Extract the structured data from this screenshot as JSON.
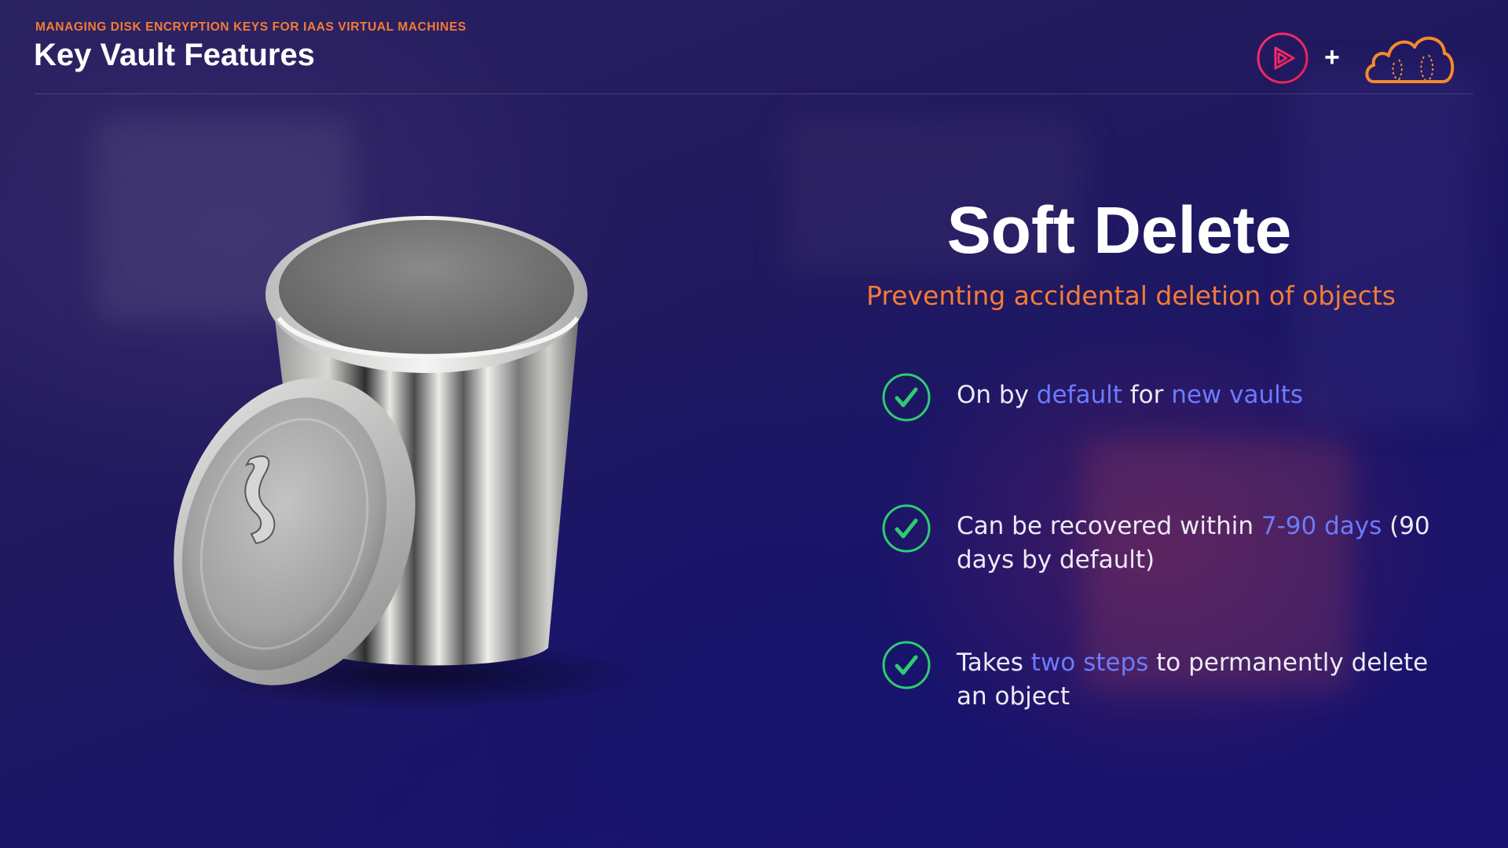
{
  "header": {
    "kicker": "MANAGING DISK ENCRYPTION KEYS FOR IAAS VIRTUAL MACHINES",
    "title": "Key Vault Features",
    "plus": "+"
  },
  "slide": {
    "title": "Soft Delete",
    "subtitle": "Preventing accidental deletion of objects",
    "features": [
      {
        "icon": "checkmark-circle-icon",
        "parts": [
          "On by ",
          "default",
          " for ",
          "new vaults"
        ]
      },
      {
        "icon": "checkmark-circle-icon",
        "parts": [
          "Can be recovered within ",
          "7-90 days",
          " (90 days by default)"
        ]
      },
      {
        "icon": "checkmark-circle-icon",
        "parts": [
          "Takes ",
          "two steps",
          " to permanently delete an object"
        ]
      }
    ]
  },
  "colors": {
    "accent_orange": "#f47b36",
    "highlight_blue": "#6b7cff",
    "check_green": "#2ecc71",
    "logo_pink": "#e8204f"
  },
  "icons": {
    "logo_left": "pluralsight-play-logo-icon",
    "logo_right": "cloud-logo-icon",
    "illustration": "trash-can-icon"
  }
}
